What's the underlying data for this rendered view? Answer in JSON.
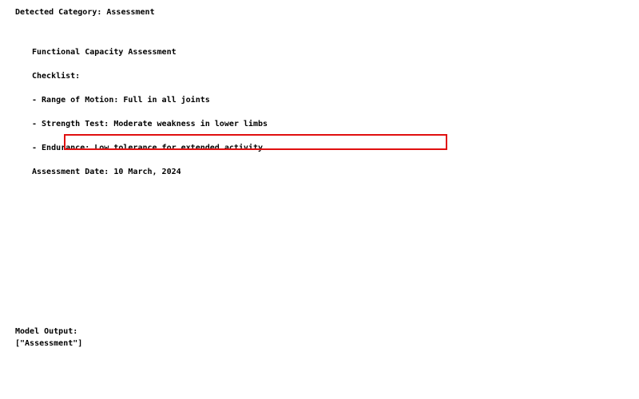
{
  "header": {
    "detected_category": "Detected Category: Assessment"
  },
  "document": {
    "title": "Functional Capacity Assessment",
    "checklist_label": "Checklist:",
    "items": [
      "- Range of Motion: Full in all joints",
      "- Strength Test: Moderate weakness in lower limbs",
      "- Endurance: Low tolerance for extended activity"
    ],
    "date_line": "Assessment Date: 10 March, 2024"
  },
  "output": {
    "label": "Model Output:",
    "value": "[\"Assessment\"]"
  },
  "colors": {
    "highlight_border": "#e01010",
    "text": "#000000",
    "background": "#ffffff"
  }
}
